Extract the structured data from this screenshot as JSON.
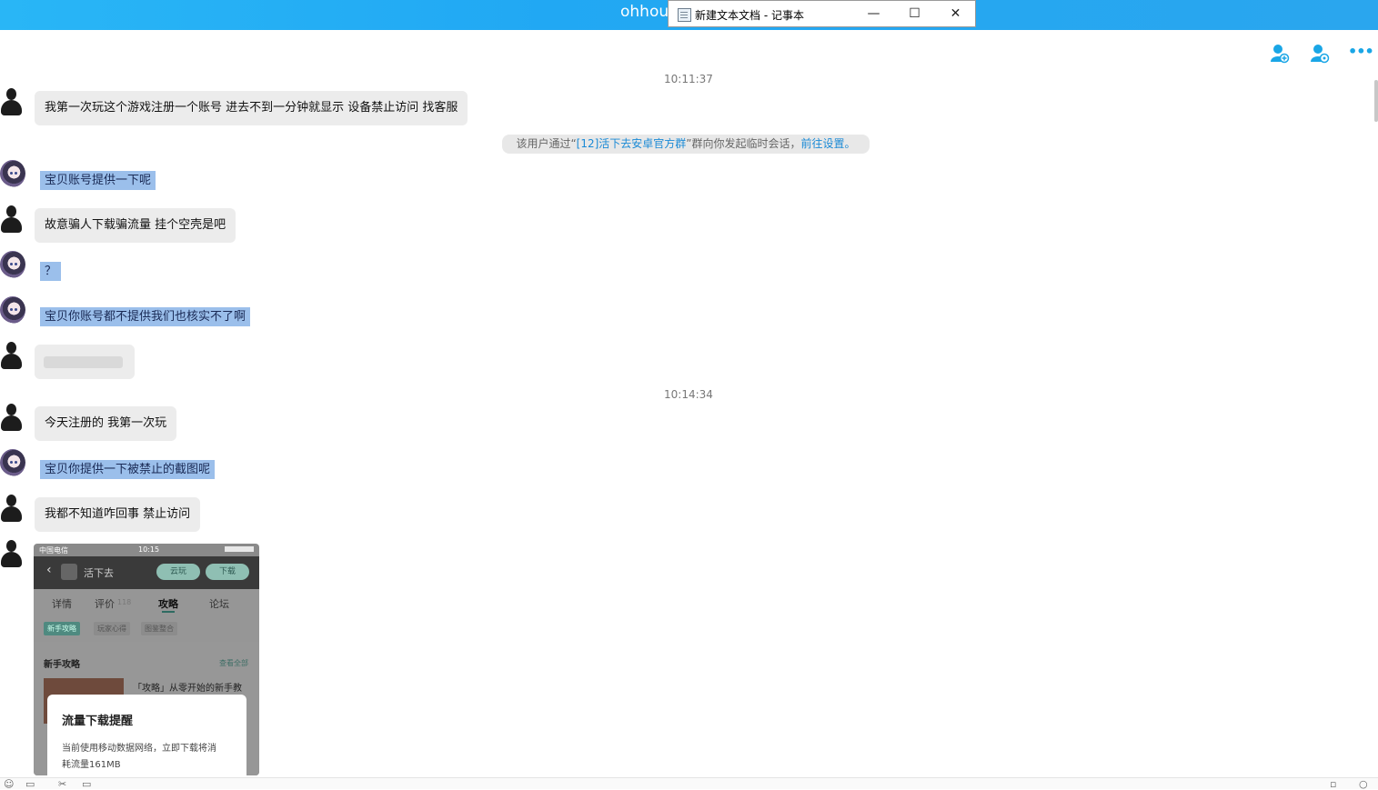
{
  "app": {
    "window_title": "ohhou",
    "notepad": {
      "title": "新建文本文档 - 记事本",
      "minimize": "—",
      "maximize": "☐",
      "close": "✕"
    }
  },
  "header_icons": {
    "add_member": "add-member-icon",
    "member_settings": "member-settings-icon",
    "more": "•••"
  },
  "chat": {
    "timestamps": [
      "10:11:37",
      "10:14:34"
    ],
    "system_notice": {
      "prefix": "该用户通过“",
      "group_link": "[12]活下去安卓官方群",
      "middle": "”群向你发起临时会话，",
      "settings_link": "前往设置",
      "suffix": "。"
    },
    "messages": [
      {
        "sender": "user",
        "text": "我第一次玩这个游戏注册一个账号 进去不到一分钟就显示 设备禁止访问 找客服"
      },
      {
        "sender": "agent",
        "text": "宝贝账号提供一下呢"
      },
      {
        "sender": "user",
        "text": "故意骗人下载骗流量 挂个空壳是吧"
      },
      {
        "sender": "agent",
        "text": "？"
      },
      {
        "sender": "agent",
        "text": "宝贝你账号都不提供我们也核实不了啊"
      },
      {
        "sender": "user",
        "text": ""
      },
      {
        "sender": "user",
        "text": "今天注册的 我第一次玩"
      },
      {
        "sender": "agent",
        "text": "宝贝你提供一下被禁止的截图呢"
      },
      {
        "sender": "user",
        "text": "我都不知道咋回事 禁止访问"
      }
    ],
    "screenshot": {
      "carrier": "中国电信",
      "time": "10:15",
      "game_name": "活下去",
      "cloud_play": "云玩",
      "download": "下载",
      "tabs": [
        "详情",
        "评价",
        "攻略",
        "论坛"
      ],
      "review_count": "118",
      "active_tab": "攻略",
      "chips": [
        "新手攻略",
        "玩家心得",
        "图鉴整合"
      ],
      "section_title": "新手攻略",
      "view_all": "查看全部",
      "article_title": "「攻略」从零开始的新手教",
      "dialog_title": "流量下载提醒",
      "dialog_body_1": "当前使用移动数据网络，立即下载将消",
      "dialog_body_2": "耗流量161MB"
    }
  },
  "colors": {
    "titlebar": "#21a8f3",
    "accent_icon": "#1aa6e6",
    "incoming_bubble": "#ececec",
    "highlight": "#9bbfeb",
    "link": "#1a8ad6"
  }
}
